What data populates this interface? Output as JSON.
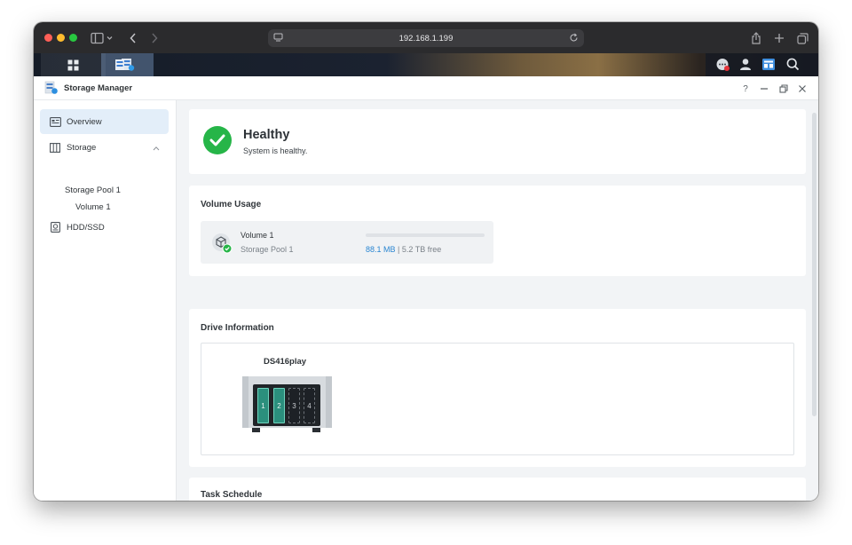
{
  "browser": {
    "url": "192.168.1.199",
    "icons": [
      "sidebar-icon",
      "back-icon",
      "forward-icon",
      "reader-icon",
      "reload-icon",
      "share-icon",
      "new-tab-icon",
      "tabs-icon"
    ]
  },
  "taskbar": {
    "icons": [
      "main-menu-icon",
      "storage-manager-icon",
      "notifications-icon",
      "user-icon",
      "widgets-icon",
      "search-icon"
    ]
  },
  "app": {
    "title": "Storage Manager",
    "controls": {
      "help": "?"
    }
  },
  "sidebar": {
    "overview": "Overview",
    "storage": "Storage",
    "storage_pool": "Storage Pool 1",
    "volume": "Volume 1",
    "hdd": "HDD/SSD"
  },
  "status": {
    "title": "Healthy",
    "message": "System is healthy.",
    "color": "#26b548"
  },
  "volume_usage": {
    "section_title": "Volume Usage",
    "volume_name": "Volume 1",
    "pool_name": "Storage Pool 1",
    "used": "88.1 MB",
    "separator": "|",
    "free": "5.2 TB free",
    "used_fraction": 0.0,
    "accent": "#2a86d1"
  },
  "drive_info": {
    "section_title": "Drive Information",
    "model": "DS416play",
    "bays": [
      {
        "label": "1",
        "installed": true
      },
      {
        "label": "2",
        "installed": true
      },
      {
        "label": "3",
        "installed": false
      },
      {
        "label": "4",
        "installed": false
      }
    ]
  },
  "task_schedule": {
    "section_title": "Task Schedule"
  }
}
